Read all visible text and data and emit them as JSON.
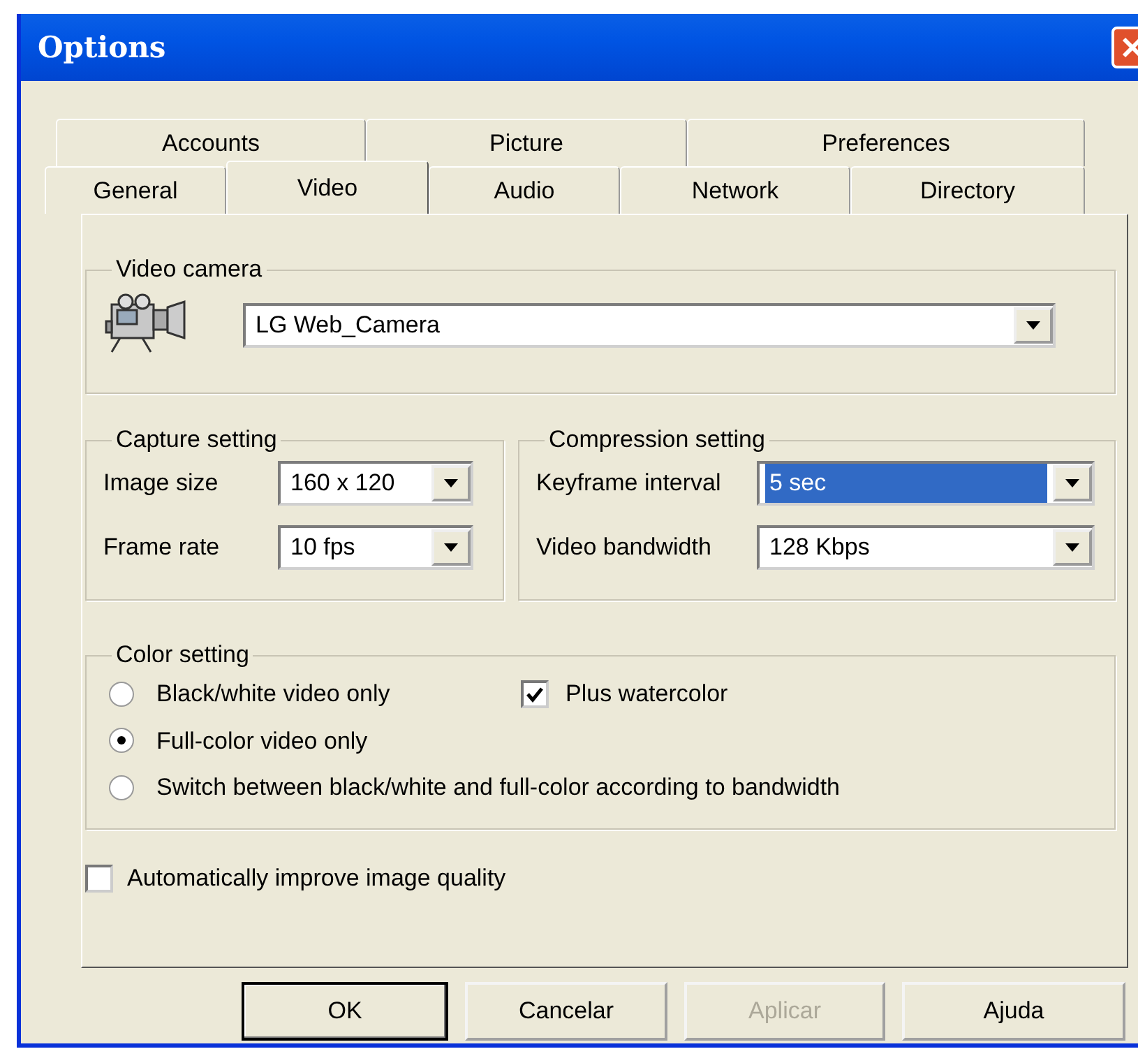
{
  "window": {
    "title": "Options"
  },
  "tab_rows": [
    {
      "tabs": [
        {
          "label": "Accounts",
          "selected": false
        },
        {
          "label": "Picture",
          "selected": false
        },
        {
          "label": "Preferences",
          "selected": false
        }
      ]
    },
    {
      "tabs": [
        {
          "label": "General",
          "selected": false
        },
        {
          "label": "Video",
          "selected": true
        },
        {
          "label": "Audio",
          "selected": false
        },
        {
          "label": "Network",
          "selected": false
        },
        {
          "label": "Directory",
          "selected": false
        }
      ]
    }
  ],
  "video_camera": {
    "title": "Video camera",
    "value": "LG Web_Camera"
  },
  "capture_setting": {
    "title": "Capture setting",
    "fields": [
      {
        "label": "Image size",
        "value": "160 x 120",
        "highlighted": false
      },
      {
        "label": "Frame rate",
        "value": "10 fps",
        "highlighted": false
      }
    ]
  },
  "compression_setting": {
    "title": "Compression setting",
    "fields": [
      {
        "label": "Keyframe interval",
        "value": "5 sec",
        "highlighted": true
      },
      {
        "label": "Video bandwidth",
        "value": "128 Kbps",
        "highlighted": false
      }
    ]
  },
  "color_setting": {
    "title": "Color setting",
    "options": [
      {
        "label": "Black/white video only",
        "selected": false
      },
      {
        "label": "Full-color video only",
        "selected": true
      },
      {
        "label": "Switch between black/white and full-color according to bandwidth",
        "selected": false
      }
    ],
    "plus_watercolor": {
      "label": "Plus watercolor",
      "checked": true
    }
  },
  "auto_improve": {
    "label": "Automatically improve image quality",
    "checked": false
  },
  "buttons": [
    {
      "label": "OK",
      "default": true,
      "disabled": false
    },
    {
      "label": "Cancelar",
      "default": false,
      "disabled": false
    },
    {
      "label": "Aplicar",
      "default": false,
      "disabled": true
    },
    {
      "label": "Ajuda",
      "default": false,
      "disabled": false
    }
  ]
}
